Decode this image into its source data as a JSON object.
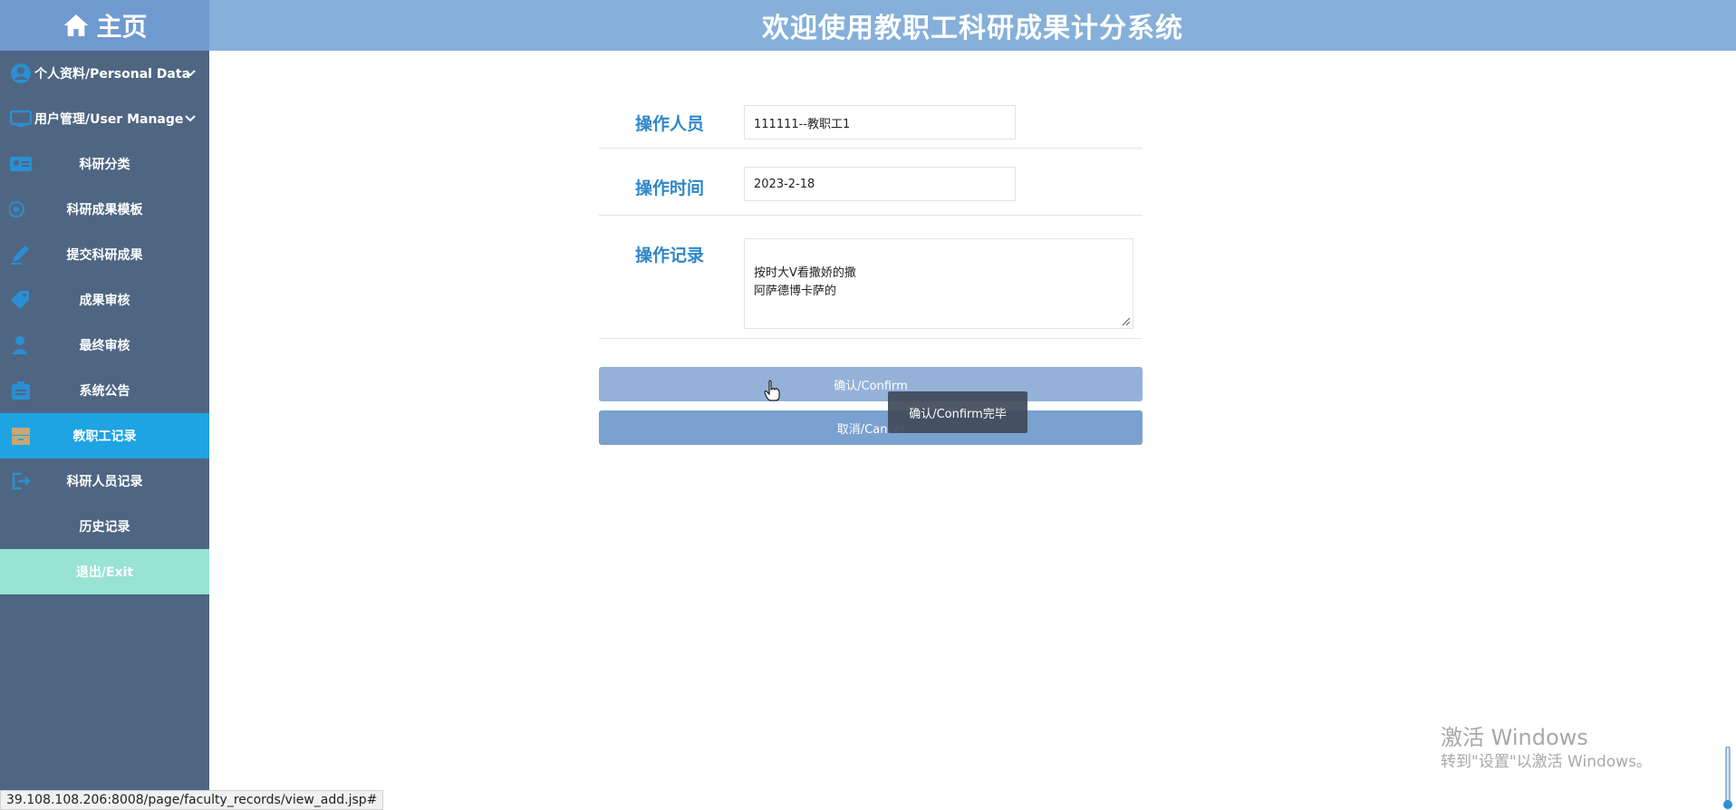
{
  "header": {
    "home_label": "主页",
    "title": "欢迎使用教职工科研成果计分系统"
  },
  "sidebar": {
    "items": [
      {
        "label": "个人资料/Personal Data",
        "icon": "user-circle-icon"
      },
      {
        "label": "用户管理/User Manage",
        "icon": "monitor-icon"
      },
      {
        "label": "科研分类",
        "icon": "id-card-icon"
      },
      {
        "label": "科研成果模板",
        "icon": "gear-icon"
      },
      {
        "label": "提交科研成果",
        "icon": "edit-icon"
      },
      {
        "label": "成果审核",
        "icon": "tag-icon"
      },
      {
        "label": "最终审核",
        "icon": "user-check-icon"
      },
      {
        "label": "系统公告",
        "icon": "board-icon"
      },
      {
        "label": "教职工记录",
        "icon": "archive-icon"
      },
      {
        "label": "科研人员记录",
        "icon": "logout-icon"
      },
      {
        "label": "历史记录",
        "icon": ""
      },
      {
        "label": "退出/Exit",
        "icon": ""
      }
    ],
    "active_index": 8,
    "colors": {
      "bg": "#4f6683",
      "active": "#1ea3e3",
      "exit": "#98e3d3"
    }
  },
  "form": {
    "operator": {
      "label": "操作人员",
      "value": "111111--教职工1"
    },
    "time": {
      "label": "操作时间",
      "value": "2023-2-18"
    },
    "record": {
      "label": "操作记录",
      "value": "按时大V看撒娇的撒\n阿萨德博卡萨的"
    },
    "confirm_label": "确认/Confirm",
    "cancel_label": "取消/Cancel"
  },
  "toast": {
    "text": "确认/Confirm完毕"
  },
  "watermark": {
    "line1": "激活 Windows",
    "line2": "转到\"设置\"以激活 Windows。"
  },
  "status_bar": {
    "url": "39.108.108.206:8008/page/faculty_records/view_add.jsp#"
  }
}
